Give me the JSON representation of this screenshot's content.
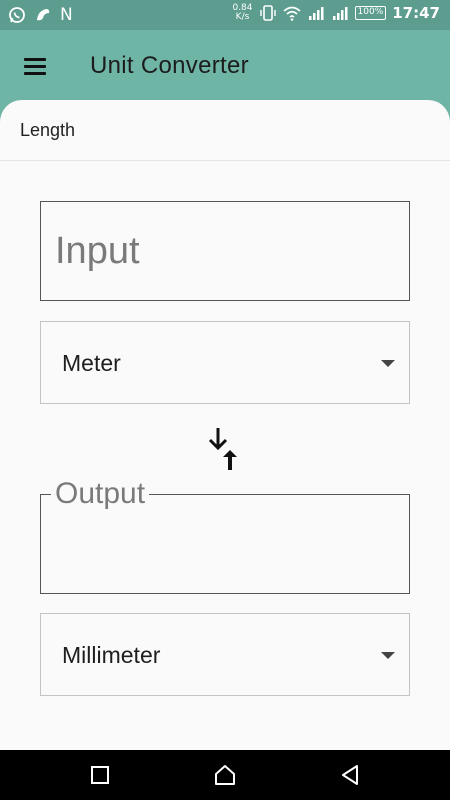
{
  "status_bar": {
    "left_icons": [
      "whatsapp-icon",
      "bird-icon",
      "n-icon"
    ],
    "n_letter": "N",
    "net_speed_value": "0.84",
    "net_speed_unit": "K/s",
    "battery": "100%",
    "time": "17:47",
    "right_icons": [
      "vibrate-icon",
      "wifi-icon",
      "signal-icon",
      "signal-icon",
      "battery-icon"
    ]
  },
  "app_bar": {
    "title": "Unit Converter",
    "menu_icon": "hamburger-menu-icon",
    "color": "#6fb5a6"
  },
  "section": {
    "title": "Length"
  },
  "converter": {
    "input_placeholder": "Input",
    "from_unit": "Meter",
    "swap_icon": "swap-arrows-icon",
    "output_label": "Output",
    "to_unit": "Millimeter"
  },
  "nav_bar": {
    "icons": [
      "recent-apps-icon",
      "home-icon",
      "back-icon"
    ]
  }
}
